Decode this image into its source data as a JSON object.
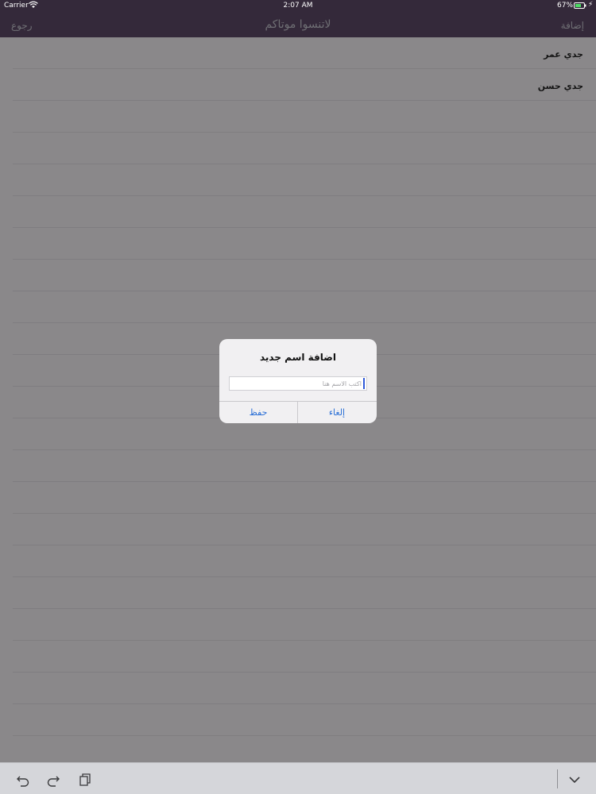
{
  "status_bar": {
    "carrier": "Carrier",
    "time": "2:07 AM",
    "battery_percent": "67%",
    "icons": [
      "wifi-icon",
      "battery-icon",
      "charging-bolt-icon"
    ]
  },
  "nav_bar": {
    "back_label": "رجوع",
    "title": "لاتنسوا موتاكم",
    "add_label": "إضافة"
  },
  "list": {
    "items": [
      {
        "label": "جدي عمر"
      },
      {
        "label": "جدي حسن"
      }
    ]
  },
  "dialog": {
    "title": "اضافة اسم جديد",
    "input_placeholder": "اكتب الاسم هنا",
    "input_value": "",
    "cancel_label": "إلغاء",
    "save_label": "حفظ"
  },
  "keyboard_toolbar": {
    "icons": [
      "undo-icon",
      "redo-icon",
      "paste-icon",
      "hide-keyboard-icon"
    ]
  },
  "colors": {
    "nav_background": "#34293a",
    "dimmed_background": "#8a888a",
    "dialog_button": "#2a6fd6",
    "cursor": "#2f59d9"
  }
}
